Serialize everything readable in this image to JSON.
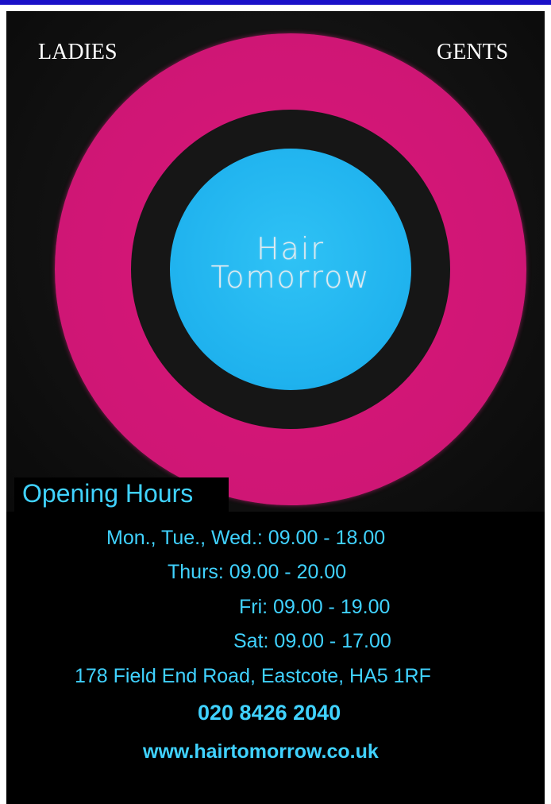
{
  "header": {
    "ladies_label": "LADIES",
    "gents_label": "GENTS"
  },
  "logo": {
    "line1": "Hair",
    "line2": "Tomorrow"
  },
  "hours": {
    "heading": "Opening Hours",
    "lines": [
      "Mon., Tue., Wed.: 09.00 - 18.00",
      "Thurs: 09.00 - 20.00",
      "Fri: 09.00 - 19.00",
      "Sat: 09.00 - 17.00"
    ]
  },
  "contact": {
    "address": "178 Field End Road, Eastcote, HA5 1RF",
    "phone": "020 8426 2040",
    "website": "www.hairtomorrow.co.uk"
  },
  "colors": {
    "top_bar": "#1a10c8",
    "ring": "#cf1675",
    "disc": "#1fb2ee",
    "text_accent": "#40d2ff",
    "background": "#000000"
  }
}
